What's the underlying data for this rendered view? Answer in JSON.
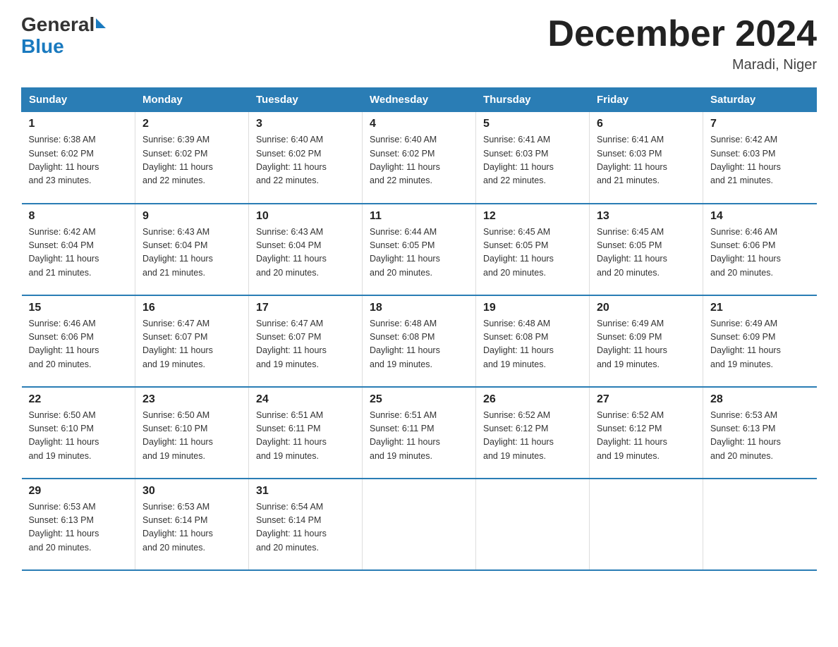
{
  "header": {
    "logo_general": "General",
    "logo_blue": "Blue",
    "title": "December 2024",
    "location": "Maradi, Niger"
  },
  "days_of_week": [
    "Sunday",
    "Monday",
    "Tuesday",
    "Wednesday",
    "Thursday",
    "Friday",
    "Saturday"
  ],
  "weeks": [
    [
      {
        "day": "1",
        "sunrise": "6:38 AM",
        "sunset": "6:02 PM",
        "daylight": "11 hours and 23 minutes."
      },
      {
        "day": "2",
        "sunrise": "6:39 AM",
        "sunset": "6:02 PM",
        "daylight": "11 hours and 22 minutes."
      },
      {
        "day": "3",
        "sunrise": "6:40 AM",
        "sunset": "6:02 PM",
        "daylight": "11 hours and 22 minutes."
      },
      {
        "day": "4",
        "sunrise": "6:40 AM",
        "sunset": "6:02 PM",
        "daylight": "11 hours and 22 minutes."
      },
      {
        "day": "5",
        "sunrise": "6:41 AM",
        "sunset": "6:03 PM",
        "daylight": "11 hours and 22 minutes."
      },
      {
        "day": "6",
        "sunrise": "6:41 AM",
        "sunset": "6:03 PM",
        "daylight": "11 hours and 21 minutes."
      },
      {
        "day": "7",
        "sunrise": "6:42 AM",
        "sunset": "6:03 PM",
        "daylight": "11 hours and 21 minutes."
      }
    ],
    [
      {
        "day": "8",
        "sunrise": "6:42 AM",
        "sunset": "6:04 PM",
        "daylight": "11 hours and 21 minutes."
      },
      {
        "day": "9",
        "sunrise": "6:43 AM",
        "sunset": "6:04 PM",
        "daylight": "11 hours and 21 minutes."
      },
      {
        "day": "10",
        "sunrise": "6:43 AM",
        "sunset": "6:04 PM",
        "daylight": "11 hours and 20 minutes."
      },
      {
        "day": "11",
        "sunrise": "6:44 AM",
        "sunset": "6:05 PM",
        "daylight": "11 hours and 20 minutes."
      },
      {
        "day": "12",
        "sunrise": "6:45 AM",
        "sunset": "6:05 PM",
        "daylight": "11 hours and 20 minutes."
      },
      {
        "day": "13",
        "sunrise": "6:45 AM",
        "sunset": "6:05 PM",
        "daylight": "11 hours and 20 minutes."
      },
      {
        "day": "14",
        "sunrise": "6:46 AM",
        "sunset": "6:06 PM",
        "daylight": "11 hours and 20 minutes."
      }
    ],
    [
      {
        "day": "15",
        "sunrise": "6:46 AM",
        "sunset": "6:06 PM",
        "daylight": "11 hours and 20 minutes."
      },
      {
        "day": "16",
        "sunrise": "6:47 AM",
        "sunset": "6:07 PM",
        "daylight": "11 hours and 19 minutes."
      },
      {
        "day": "17",
        "sunrise": "6:47 AM",
        "sunset": "6:07 PM",
        "daylight": "11 hours and 19 minutes."
      },
      {
        "day": "18",
        "sunrise": "6:48 AM",
        "sunset": "6:08 PM",
        "daylight": "11 hours and 19 minutes."
      },
      {
        "day": "19",
        "sunrise": "6:48 AM",
        "sunset": "6:08 PM",
        "daylight": "11 hours and 19 minutes."
      },
      {
        "day": "20",
        "sunrise": "6:49 AM",
        "sunset": "6:09 PM",
        "daylight": "11 hours and 19 minutes."
      },
      {
        "day": "21",
        "sunrise": "6:49 AM",
        "sunset": "6:09 PM",
        "daylight": "11 hours and 19 minutes."
      }
    ],
    [
      {
        "day": "22",
        "sunrise": "6:50 AM",
        "sunset": "6:10 PM",
        "daylight": "11 hours and 19 minutes."
      },
      {
        "day": "23",
        "sunrise": "6:50 AM",
        "sunset": "6:10 PM",
        "daylight": "11 hours and 19 minutes."
      },
      {
        "day": "24",
        "sunrise": "6:51 AM",
        "sunset": "6:11 PM",
        "daylight": "11 hours and 19 minutes."
      },
      {
        "day": "25",
        "sunrise": "6:51 AM",
        "sunset": "6:11 PM",
        "daylight": "11 hours and 19 minutes."
      },
      {
        "day": "26",
        "sunrise": "6:52 AM",
        "sunset": "6:12 PM",
        "daylight": "11 hours and 19 minutes."
      },
      {
        "day": "27",
        "sunrise": "6:52 AM",
        "sunset": "6:12 PM",
        "daylight": "11 hours and 19 minutes."
      },
      {
        "day": "28",
        "sunrise": "6:53 AM",
        "sunset": "6:13 PM",
        "daylight": "11 hours and 20 minutes."
      }
    ],
    [
      {
        "day": "29",
        "sunrise": "6:53 AM",
        "sunset": "6:13 PM",
        "daylight": "11 hours and 20 minutes."
      },
      {
        "day": "30",
        "sunrise": "6:53 AM",
        "sunset": "6:14 PM",
        "daylight": "11 hours and 20 minutes."
      },
      {
        "day": "31",
        "sunrise": "6:54 AM",
        "sunset": "6:14 PM",
        "daylight": "11 hours and 20 minutes."
      },
      null,
      null,
      null,
      null
    ]
  ],
  "labels": {
    "sunrise": "Sunrise:",
    "sunset": "Sunset:",
    "daylight": "Daylight:"
  }
}
